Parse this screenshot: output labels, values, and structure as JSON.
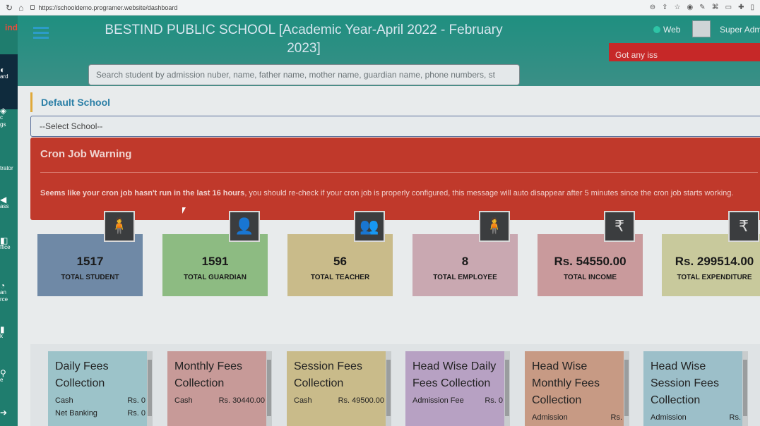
{
  "browser": {
    "url": "https://schooldemo.programer.website/dashboard"
  },
  "sidebar": {
    "logo": "ind",
    "items": [
      {
        "icon": "dashboard-icon",
        "label": "ard"
      },
      {
        "icon": "academic-icon",
        "label": "c\ngs"
      },
      {
        "icon": "administrator-icon",
        "label": "trator"
      },
      {
        "icon": "class-icon",
        "label": "ass"
      },
      {
        "icon": "office-icon",
        "label": "ffice"
      },
      {
        "icon": "human-resource-icon",
        "label": "an\nrce"
      },
      {
        "icon": "book-icon",
        "label": "k"
      },
      {
        "icon": "attendance-icon",
        "label": "e"
      }
    ]
  },
  "header": {
    "title": "BESTIND PUBLIC SCHOOL [Academic Year-April 2022 - February 2023]",
    "web_label": "Web",
    "user_label": "Super Adm",
    "search_placeholder": "Search student by admission nuber, name, father name, mother name, guardian name, phone numbers, st",
    "issue_prompt": "Got any iss"
  },
  "main": {
    "default_school_label": "Default School",
    "school_select_value": "--Select School--",
    "cron_warning": {
      "title": "Cron Job Warning",
      "message_bold": "Seems like your cron job hasn't run in the last 16 hours",
      "message_rest": ", you should re-check if your cron job is properly configured, this message will auto disappear after 5 minutes since the cron job starts working."
    },
    "stats": [
      {
        "value": "1517",
        "label": "TOTAL STUDENT",
        "icon": "student-icon",
        "glyph": "🧍",
        "color": "#6f89a6"
      },
      {
        "value": "1591",
        "label": "TOTAL GUARDIAN",
        "icon": "guardian-icon",
        "glyph": "👤",
        "color": "#8dbb82"
      },
      {
        "value": "56",
        "label": "TOTAL TEACHER",
        "icon": "teacher-icon",
        "glyph": "👥",
        "color": "#c9bb8a"
      },
      {
        "value": "8",
        "label": "TOTAL EMPLOYEE",
        "icon": "employee-icon",
        "glyph": "🧍",
        "color": "#c9a8b1"
      },
      {
        "value": "Rs. 54550.00",
        "label": "TOTAL INCOME",
        "icon": "rupee-icon",
        "glyph": "₹",
        "color": "#c99a9c"
      },
      {
        "value": "Rs. 299514.00",
        "label": "TOTAL EXPENDITURE",
        "icon": "rupee-icon",
        "glyph": "₹",
        "color": "#c8c99c"
      }
    ],
    "fees": [
      {
        "title": "Daily Fees Collection",
        "color": "#9cc3c9",
        "rows": [
          [
            "Cash",
            "Rs. 0"
          ],
          [
            "Net Banking",
            "Rs. 0"
          ]
        ]
      },
      {
        "title": "Monthly Fees Collection",
        "color": "#c79a98",
        "rows": [
          [
            "Cash",
            "Rs. 30440.00"
          ]
        ]
      },
      {
        "title": "Session Fees Collection",
        "color": "#c9bb8a",
        "rows": [
          [
            "Cash",
            "Rs. 49500.00"
          ]
        ]
      },
      {
        "title": "Head Wise Daily Fees Collection",
        "color": "#b7a1c3",
        "rows": [
          [
            "Admission Fee",
            "Rs. 0"
          ]
        ]
      },
      {
        "title": "Head Wise Monthly Fees Collection",
        "color": "#c79a84",
        "rows": [
          [
            "Admission",
            "Rs."
          ]
        ]
      },
      {
        "title": "Head Wise Session Fees Collection",
        "color": "#9cbfc9",
        "rows": [
          [
            "Admission",
            "Rs."
          ]
        ]
      }
    ]
  }
}
